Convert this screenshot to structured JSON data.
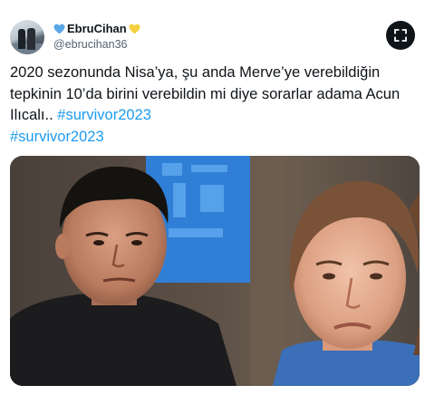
{
  "author": {
    "display_name": "EbruCihan",
    "handle": "@ebrucihan36",
    "avatar_icon": "profile-photo",
    "heart_left_color": "#5aa7e8",
    "heart_right_color": "#f5d142"
  },
  "header": {
    "expand_icon": "expand-icon"
  },
  "tweet": {
    "text_main": "2020 sezonunda Nisa’ya, şu anda Merve’ye verebildiğin tepkinin 10’da birini verebildin mi diye sorarlar adama Acun Ilıcalı.. ",
    "hashtag_1": "#survivor2023",
    "hashtag_2": "#survivor2023",
    "hashtag_color": "#1d9bf0"
  },
  "media": {
    "type": "photo"
  }
}
